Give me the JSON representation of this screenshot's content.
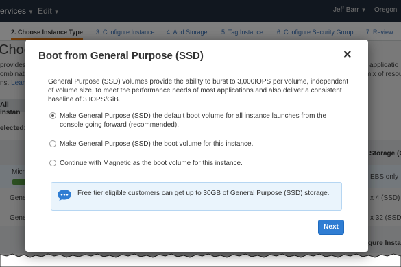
{
  "topbar": {
    "services": "ervices",
    "edit": "Edit",
    "user": "Jeff Barr",
    "region": "Oregon"
  },
  "steps": [
    "2. Choose Instance Type",
    "3. Configure Instance",
    "4. Add Storage",
    "5. Tag Instance",
    "6. Configure Security Group",
    "7. Review"
  ],
  "background": {
    "title": "Choos",
    "line1_left": "provides a",
    "line1_right": "applicatio",
    "line2_left": "ombinatio",
    "line2_right": "mix of resou",
    "line3_left": "ns. ",
    "line3_link": "Learn",
    "all_instances": "All instan",
    "selected": "elected:",
    "storage_header": "Storage (GB",
    "row1_left": "Micr",
    "row1_right": "EBS only",
    "row2_left": "Gene",
    "row2_right": "x 4 (SSD)",
    "row3_left": "Gene",
    "row3_right": "x 32 (SSD)",
    "footer_right": "gure Insta"
  },
  "modal": {
    "title": "Boot from General Purpose (SSD)",
    "close": "×",
    "description": "General Purpose (SSD) volumes provide the ability to burst to 3,000IOPS per volume, independent of volume size, to meet the performance needs of most applications and also deliver a consistent baseline of 3 IOPS/GiB.",
    "options": [
      {
        "label": "Make General Purpose (SSD) the default boot volume for all instance launches from the console going forward (recommended).",
        "checked": true
      },
      {
        "label": "Make General Purpose (SSD) the boot volume for this instance.",
        "checked": false
      },
      {
        "label": "Continue with Magnetic as the boot volume for this instance.",
        "checked": false
      }
    ],
    "info": "Free tier eligible customers can get up to 30GB of General Purpose (SSD) storage.",
    "next": "Next"
  },
  "colors": {
    "primary": "#2f7dd3",
    "info_bg": "#eaf4fc",
    "topbar": "#232f3e"
  }
}
